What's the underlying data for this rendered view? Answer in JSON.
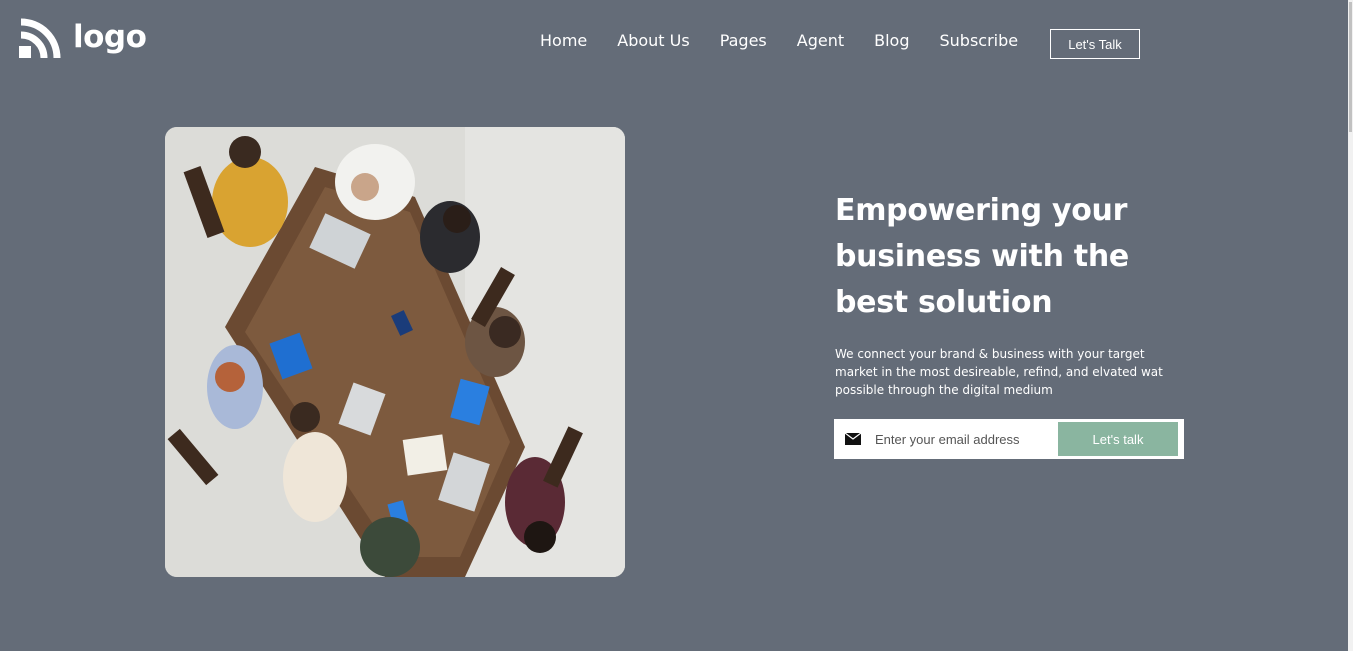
{
  "header": {
    "logo_text": "logo",
    "nav": [
      "Home",
      "About Us",
      "Pages",
      "Agent",
      "Blog",
      "Subscribe"
    ],
    "cta_label": "Let's Talk"
  },
  "hero": {
    "title": "Empowering your business with the best solution",
    "subtitle": "We connect your brand & business with your target market in the most desireable, refind, and elvated wat possible through the digital medium",
    "email_placeholder": "Enter your email address",
    "submit_label": "Let's talk",
    "image": "team-meeting-photo"
  },
  "colors": {
    "background": "#646c78",
    "button_accent": "#8ab5a0",
    "text": "#ffffff"
  }
}
